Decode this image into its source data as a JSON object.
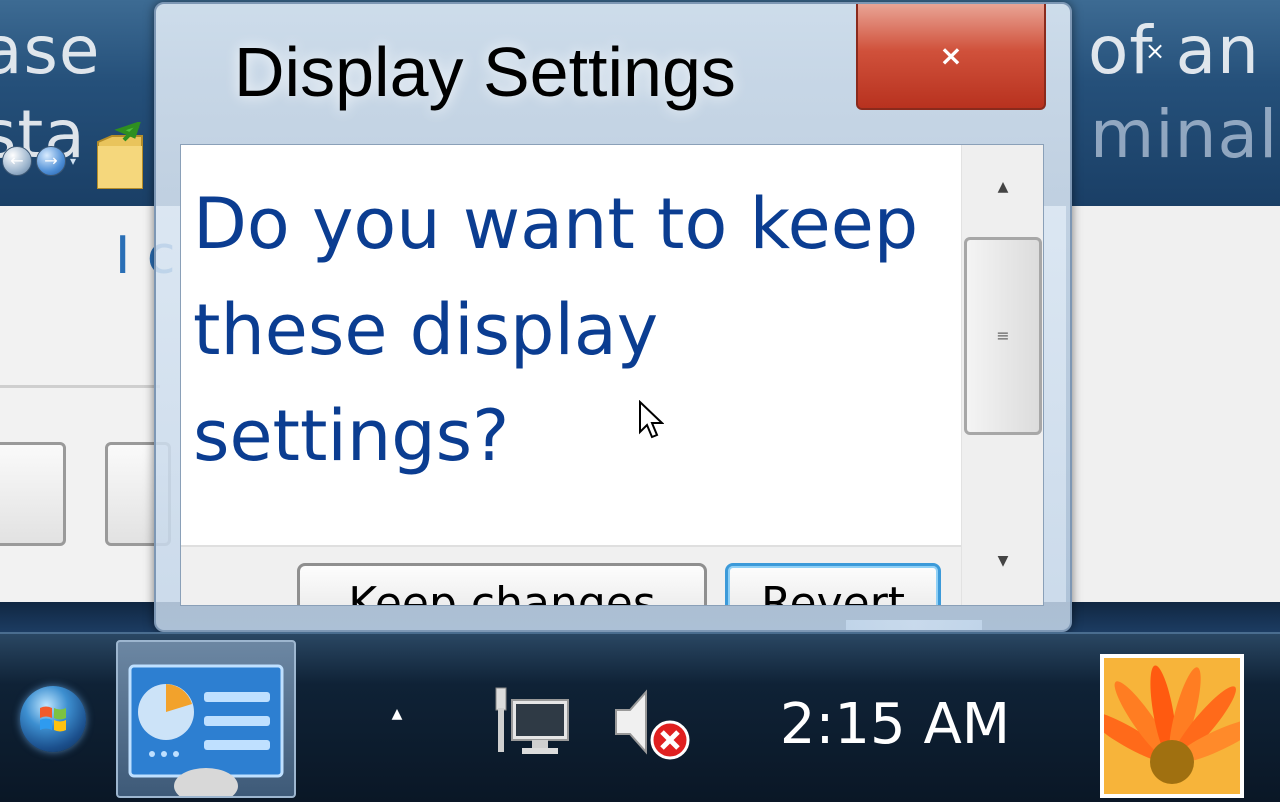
{
  "background_window": {
    "title_left_top": "ase",
    "title_left_bottom": "sta",
    "title_right_top": "of an",
    "title_right_bottom": "minal",
    "partial_text": "I c",
    "close_glyph": "×"
  },
  "dialog": {
    "title": "Display Settings",
    "close_glyph": "×",
    "message": "Do you want to keep these display settings?",
    "buttons": {
      "keep": "Keep changes",
      "revert": "Revert"
    },
    "scroll": {
      "up_glyph": "▲",
      "down_glyph": "▼",
      "thumb_grip": "≡"
    }
  },
  "taskbar": {
    "clock": "2:15 AM",
    "tray_arrow_glyph": "▲",
    "icons": [
      "windows-start-orb",
      "control-panel-display-icon",
      "network-icon",
      "volume-muted-icon",
      "desktop-thumbnail"
    ]
  },
  "colors": {
    "message_text": "#0b3d91",
    "close_button": "#c9432e",
    "revert_focus": "#3c9ad9"
  }
}
